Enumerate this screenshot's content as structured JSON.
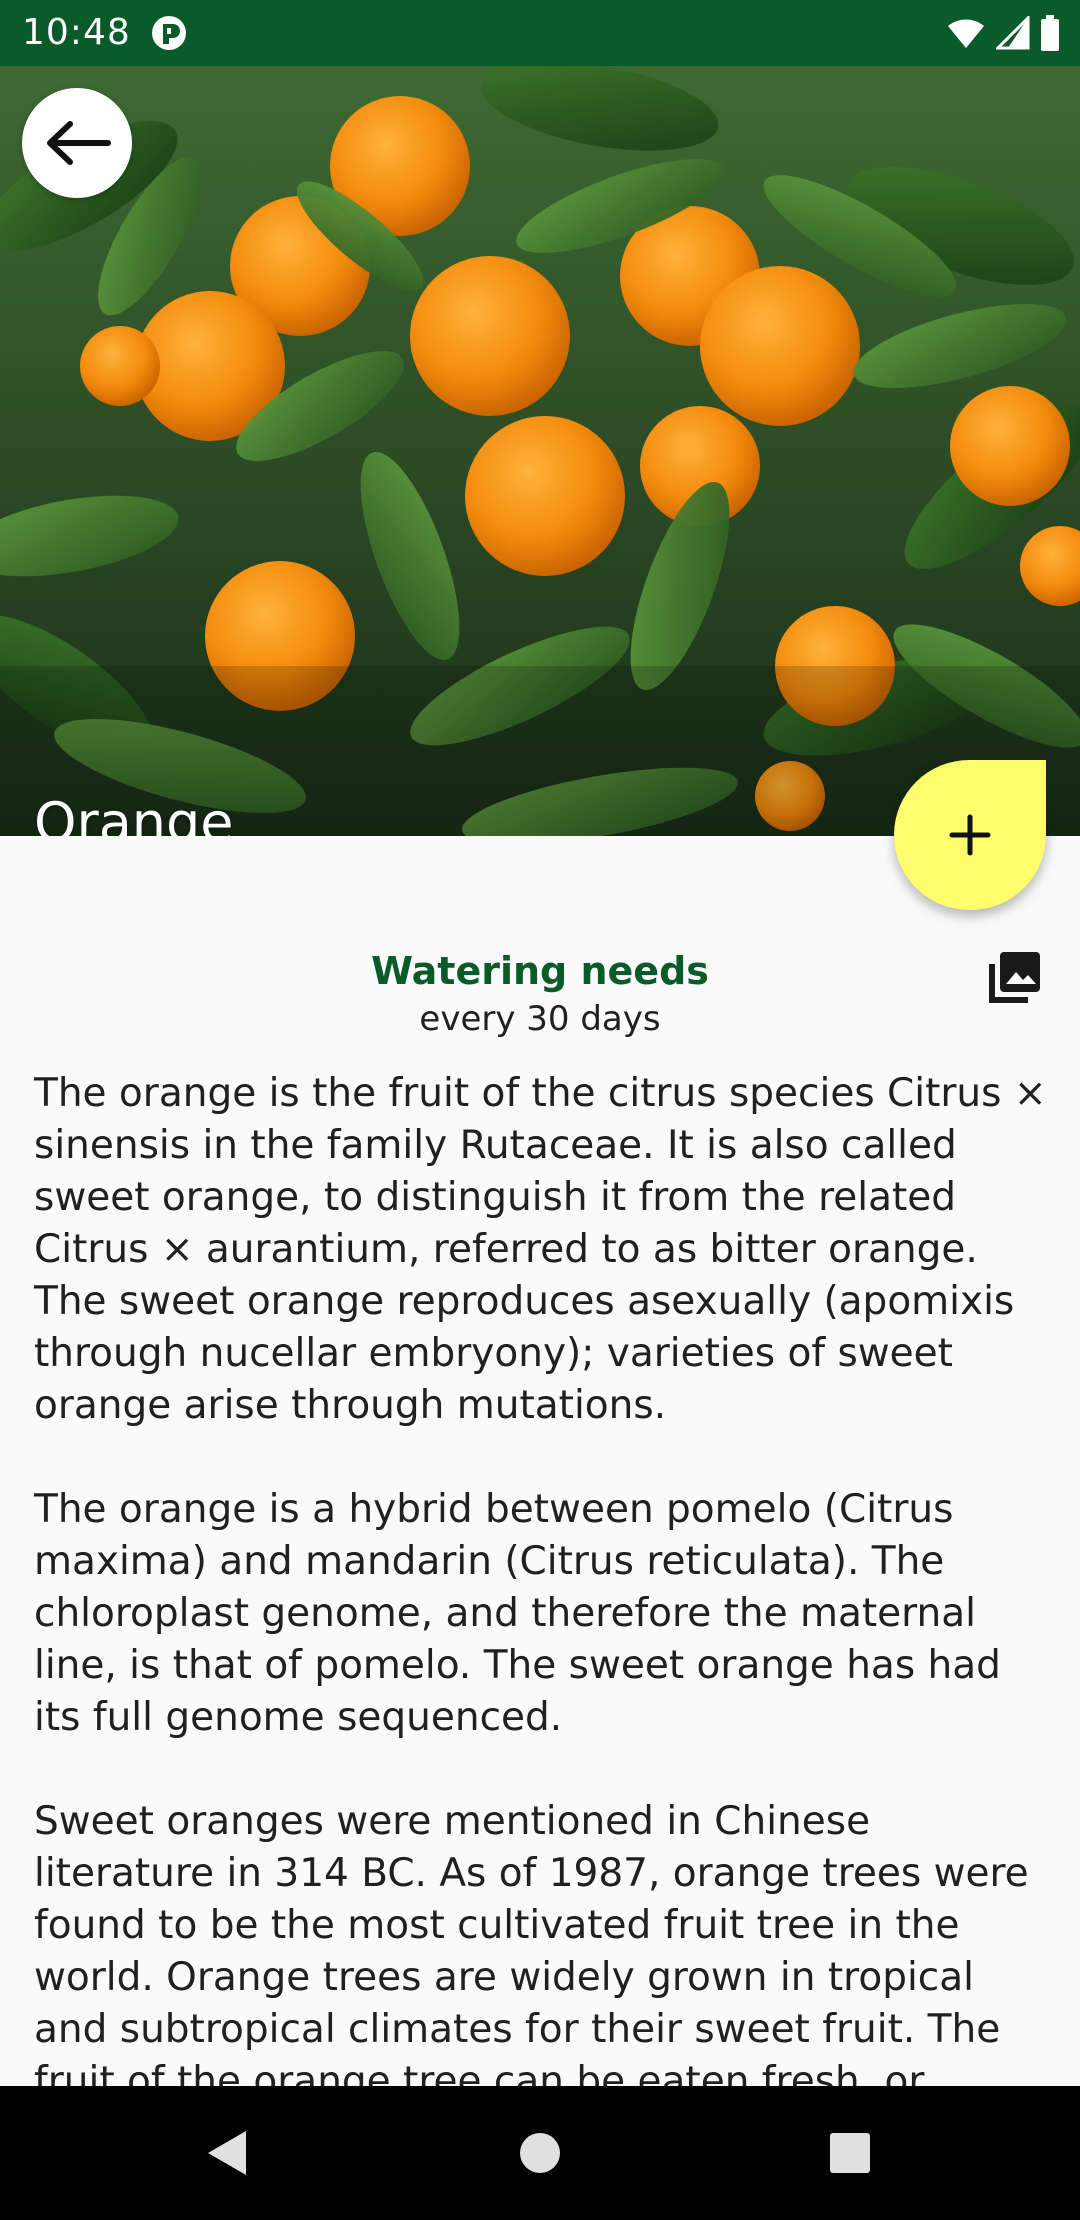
{
  "status_bar": {
    "time": "10:48",
    "icons": [
      "app-notification-icon",
      "wifi-icon",
      "signal-icon",
      "battery-icon"
    ]
  },
  "hero": {
    "title": "Orange",
    "image": "orange-tree-photo"
  },
  "colors": {
    "status_bar": "#0b5a2a",
    "accent_green": "#0b5a2a",
    "fab_yellow": "#ffff6b",
    "background": "#fafafa"
  },
  "watering": {
    "label": "Watering needs",
    "value": "every 30 days"
  },
  "description": {
    "paragraphs": [
      "The orange is the fruit of the citrus species Citrus × sinensis in the family Rutaceae. It is also called sweet orange, to distinguish it from the related Citrus × aurantium, referred to as bitter orange. The sweet orange reproduces asexually (apomixis through nucellar embryony); varieties of sweet orange arise through mutations.",
      "The orange is a hybrid between pomelo (Citrus maxima) and mandarin (Citrus reticulata). The chloroplast genome, and therefore the maternal line, is that of pomelo. The sweet orange has had its full genome sequenced.",
      "Sweet oranges were mentioned in Chinese literature in 314 BC. As of 1987, orange trees were found to be the most cultivated fruit tree in the world. Orange trees are widely grown in tropical and subtropical climates for their sweet fruit. The fruit of the orange tree can be eaten fresh, or processed for its juice or"
    ]
  },
  "fab": {
    "icon": "plus-icon"
  },
  "nav_bar": {
    "buttons": [
      "back-triangle-icon",
      "home-circle-icon",
      "recents-square-icon"
    ]
  }
}
